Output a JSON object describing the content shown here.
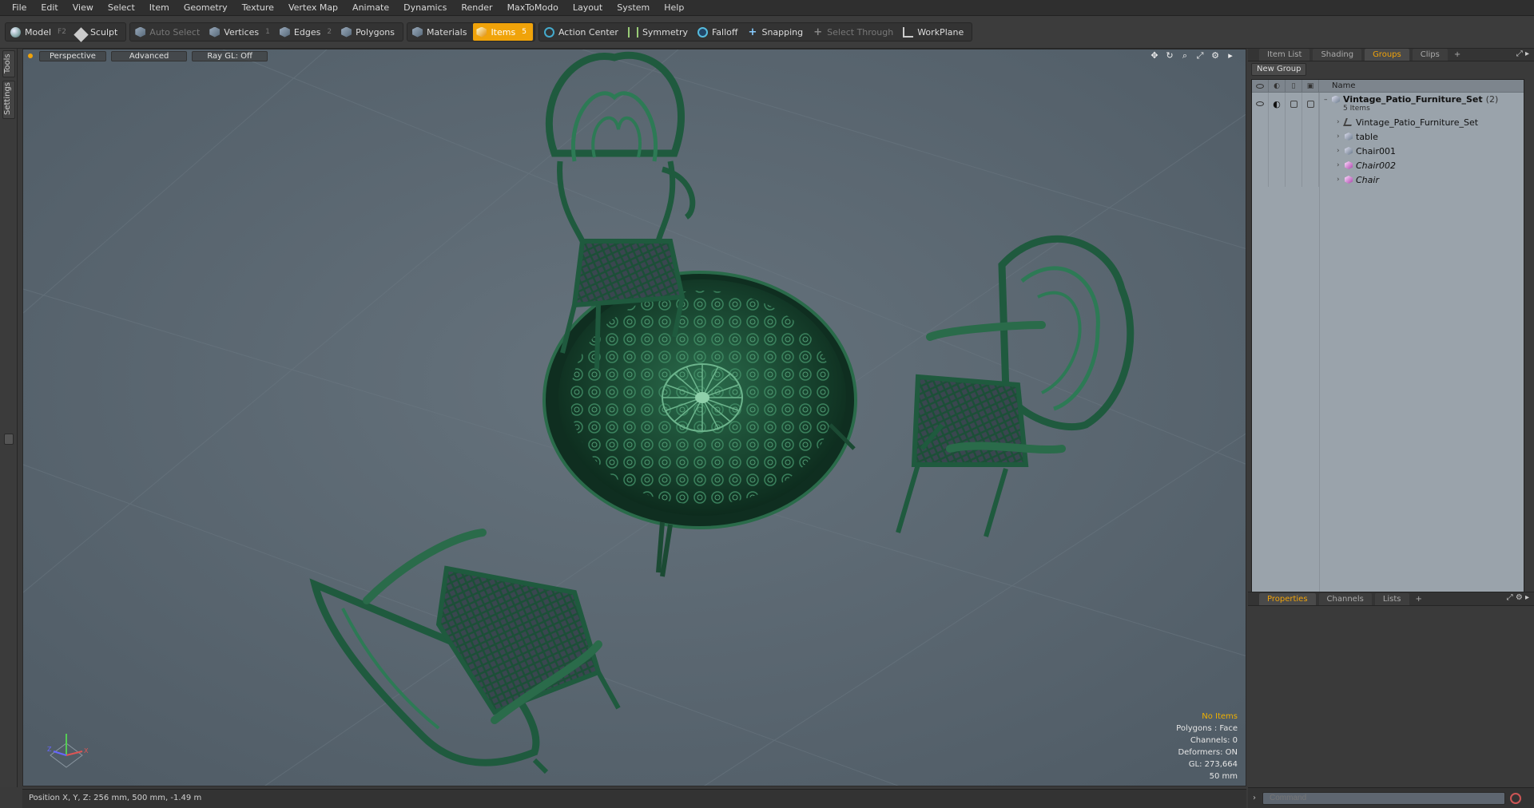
{
  "menu": [
    "File",
    "Edit",
    "View",
    "Select",
    "Item",
    "Geometry",
    "Texture",
    "Vertex Map",
    "Animate",
    "Dynamics",
    "Render",
    "MaxToModo",
    "Layout",
    "System",
    "Help"
  ],
  "toolbar": {
    "model": "Model",
    "model_key": "F2",
    "sculpt": "Sculpt",
    "auto_select": "Auto Select",
    "vertices": "Vertices",
    "vertices_key": "1",
    "edges": "Edges",
    "edges_key": "2",
    "polygons": "Polygons",
    "materials": "Materials",
    "items": "Items",
    "items_key": "5",
    "action_center": "Action Center",
    "symmetry": "Symmetry",
    "falloff": "Falloff",
    "snapping": "Snapping",
    "select_through": "Select Through",
    "workplane": "WorkPlane"
  },
  "left_tabs": [
    "Tools",
    "Settings"
  ],
  "viewport": {
    "view": "Perspective",
    "mode": "Advanced",
    "raygl": "Ray GL: Off",
    "hud": {
      "selection": "No Items",
      "polygons": "Polygons : Face",
      "channels": "Channels: 0",
      "deformers": "Deformers: ON",
      "gl": "GL: 273,664",
      "scale": "50 mm"
    },
    "bg_color": "#5a6670",
    "model_color": "#1f5a3e"
  },
  "status": "Position X, Y, Z:  256 mm, 500 mm, -1.49 m",
  "panel": {
    "tabs": [
      "Item List",
      "Shading",
      "Groups",
      "Clips",
      "+"
    ],
    "active_tab": "Groups",
    "new_group": "New Group",
    "column_name": "Name",
    "root": {
      "name": "Vintage_Patio_Furniture_Set",
      "count": "(2)",
      "sub": "5 Items"
    },
    "items": [
      {
        "name": "Vintage_Patio_Furniture_Set",
        "type": "locator"
      },
      {
        "name": "table",
        "type": "mesh"
      },
      {
        "name": "Chair001",
        "type": "mesh"
      },
      {
        "name": "Chair002",
        "type": "mesh-instance"
      },
      {
        "name": "Chair",
        "type": "mesh-instance"
      }
    ],
    "bottom_tabs": [
      "Properties",
      "Channels",
      "Lists",
      "+"
    ],
    "bottom_active": "Properties",
    "command_placeholder": "Command"
  }
}
